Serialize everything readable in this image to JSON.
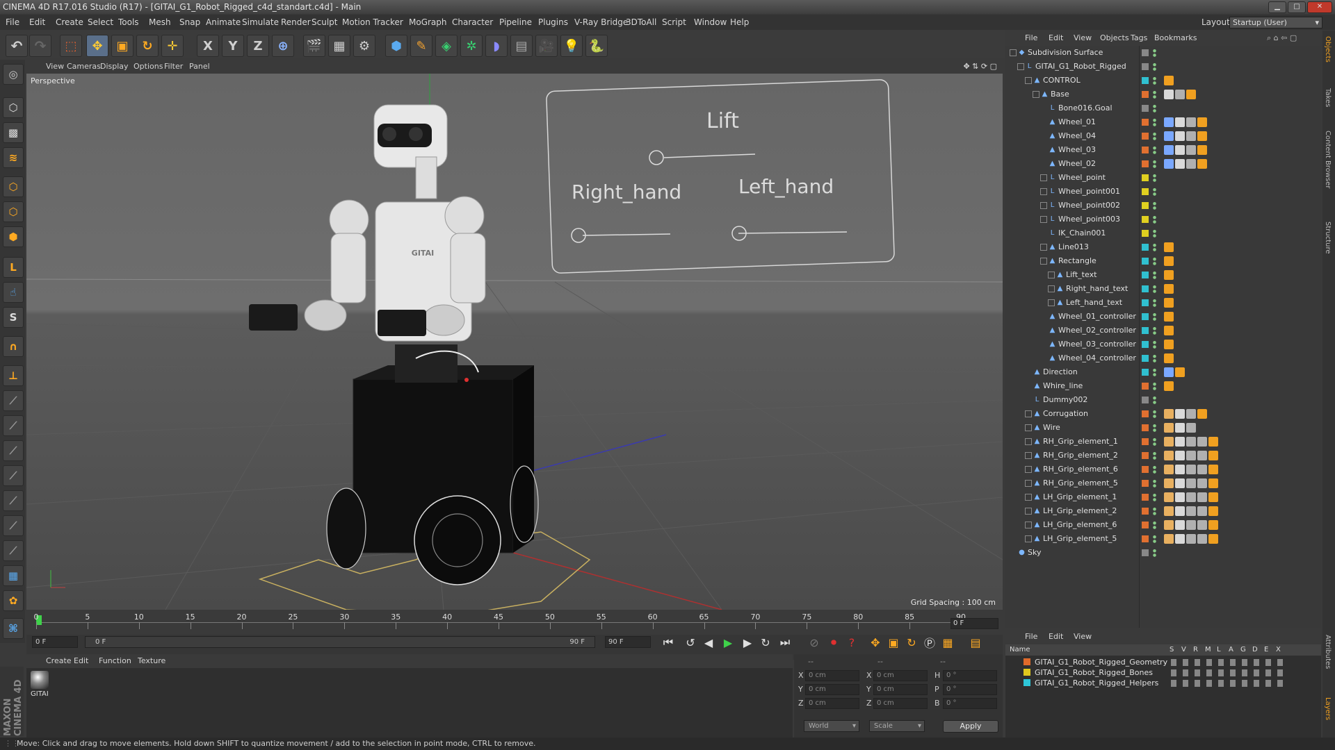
{
  "window": {
    "title": "CINEMA 4D R17.016 Studio (R17) - [GITAI_G1_Robot_Rigged_c4d_standart.c4d] - Main"
  },
  "menu": [
    "File",
    "Edit",
    "Create",
    "Select",
    "Tools",
    "Mesh",
    "Snap",
    "Animate",
    "Simulate",
    "Render",
    "Sculpt",
    "Motion Tracker",
    "MoGraph",
    "Character",
    "Pipeline",
    "Plugins",
    "V-Ray Bridge",
    "3DToAll",
    "Script",
    "Window",
    "Help"
  ],
  "layout": {
    "label": "Layout:",
    "value": "Startup (User)"
  },
  "toolbar": {
    "x_axis": "X",
    "y_axis": "Y",
    "z_axis": "Z"
  },
  "viewport": {
    "menu": [
      "View",
      "Cameras",
      "Display",
      "Options",
      "Filter",
      "Panel"
    ],
    "label": "Perspective",
    "grid_spacing": "Grid Spacing : 100 cm",
    "hud": {
      "lift": "Lift",
      "right_hand": "Right_hand",
      "left_hand": "Left_hand"
    },
    "robot_chest": "GITAI"
  },
  "timeline": {
    "ticks": [
      "0",
      "5",
      "10",
      "15",
      "20",
      "25",
      "30",
      "35",
      "40",
      "45",
      "50",
      "55",
      "60",
      "65",
      "70",
      "75",
      "80",
      "85",
      "90"
    ],
    "current_frame": "0 F",
    "start_field": "0 F",
    "range_start": "0 F",
    "range_end": "90 F",
    "end_field": "90 F"
  },
  "material_manager": {
    "menu": [
      "Create",
      "Edit",
      "Function",
      "Texture"
    ],
    "material_name": "GITAI"
  },
  "coordinates": {
    "headers": [
      "--",
      "--",
      "--"
    ],
    "rows": [
      {
        "axis": "X",
        "pos": "0 cm",
        "size_axis": "X",
        "size": "0 cm",
        "rot_axis": "H",
        "rot": "0 °"
      },
      {
        "axis": "Y",
        "pos": "0 cm",
        "size_axis": "Y",
        "size": "0 cm",
        "rot_axis": "P",
        "rot": "0 °"
      },
      {
        "axis": "Z",
        "pos": "0 cm",
        "size_axis": "Z",
        "size": "0 cm",
        "rot_axis": "B",
        "rot": "0 °"
      }
    ],
    "mode": "World",
    "scale": "Scale",
    "apply": "Apply"
  },
  "status": "Move: Click and drag to move elements. Hold down SHIFT to quantize movement / add to the selection in point mode, CTRL to remove.",
  "brand": "MAXON CINEMA 4D",
  "object_manager": {
    "menu": [
      "File",
      "Edit",
      "View",
      "Objects",
      "Tags",
      "Bookmarks"
    ],
    "items": [
      {
        "name": "Subdivision Surface",
        "indent": 0,
        "exp": "−",
        "icon": "◆",
        "color": "#888888",
        "tags": []
      },
      {
        "name": "GITAI_G1_Robot_Rigged",
        "indent": 1,
        "exp": "−",
        "icon": "L",
        "color": "#888888",
        "tags": []
      },
      {
        "name": "CONTROL",
        "indent": 2,
        "exp": "−",
        "icon": "▲",
        "color": "#30c0d0",
        "tags": [
          "o"
        ]
      },
      {
        "name": "Base",
        "indent": 3,
        "exp": "−",
        "icon": "▲",
        "color": "#e07030",
        "tags": [
          "m",
          "c",
          "o"
        ]
      },
      {
        "name": "Bone016.Goal",
        "indent": 4,
        "exp": "",
        "icon": "L",
        "color": "#888888",
        "tags": []
      },
      {
        "name": "Wheel_01",
        "indent": 4,
        "exp": "",
        "icon": "▲",
        "color": "#e07030",
        "tags": [
          "v",
          "m",
          "c",
          "o"
        ]
      },
      {
        "name": "Wheel_04",
        "indent": 4,
        "exp": "",
        "icon": "▲",
        "color": "#e07030",
        "tags": [
          "v",
          "m",
          "c",
          "o"
        ]
      },
      {
        "name": "Wheel_03",
        "indent": 4,
        "exp": "",
        "icon": "▲",
        "color": "#e07030",
        "tags": [
          "v",
          "m",
          "c",
          "o"
        ]
      },
      {
        "name": "Wheel_02",
        "indent": 4,
        "exp": "",
        "icon": "▲",
        "color": "#e07030",
        "tags": [
          "v",
          "m",
          "c",
          "o"
        ]
      },
      {
        "name": "Wheel_point",
        "indent": 4,
        "exp": "+",
        "icon": "L",
        "color": "#e0d020",
        "tags": []
      },
      {
        "name": "Wheel_point001",
        "indent": 4,
        "exp": "+",
        "icon": "L",
        "color": "#e0d020",
        "tags": []
      },
      {
        "name": "Wheel_point002",
        "indent": 4,
        "exp": "+",
        "icon": "L",
        "color": "#e0d020",
        "tags": []
      },
      {
        "name": "Wheel_point003",
        "indent": 4,
        "exp": "+",
        "icon": "L",
        "color": "#e0d020",
        "tags": []
      },
      {
        "name": "IK_Chain001",
        "indent": 4,
        "exp": "",
        "icon": "L",
        "color": "#e0d020",
        "tags": []
      },
      {
        "name": "Line013",
        "indent": 4,
        "exp": "+",
        "icon": "▲",
        "color": "#30c0d0",
        "tags": [
          "o"
        ]
      },
      {
        "name": "Rectangle",
        "indent": 4,
        "exp": "−",
        "icon": "▲",
        "color": "#30c0d0",
        "tags": [
          "o"
        ]
      },
      {
        "name": "Lift_text",
        "indent": 5,
        "exp": "+",
        "icon": "▲",
        "color": "#30c0d0",
        "tags": [
          "o"
        ]
      },
      {
        "name": "Right_hand_text",
        "indent": 5,
        "exp": "+",
        "icon": "▲",
        "color": "#30c0d0",
        "tags": [
          "o"
        ]
      },
      {
        "name": "Left_hand_text",
        "indent": 5,
        "exp": "+",
        "icon": "▲",
        "color": "#30c0d0",
        "tags": [
          "o"
        ]
      },
      {
        "name": "Wheel_01_controller",
        "indent": 4,
        "exp": "",
        "icon": "▲",
        "color": "#30c0d0",
        "tags": [
          "o"
        ]
      },
      {
        "name": "Wheel_02_controller",
        "indent": 4,
        "exp": "",
        "icon": "▲",
        "color": "#30c0d0",
        "tags": [
          "o"
        ]
      },
      {
        "name": "Wheel_03_controller",
        "indent": 4,
        "exp": "",
        "icon": "▲",
        "color": "#30c0d0",
        "tags": [
          "o"
        ]
      },
      {
        "name": "Wheel_04_controller",
        "indent": 4,
        "exp": "",
        "icon": "▲",
        "color": "#30c0d0",
        "tags": [
          "o"
        ]
      },
      {
        "name": "Direction",
        "indent": 2,
        "exp": "",
        "icon": "▲",
        "color": "#30c0d0",
        "tags": [
          "v",
          "o"
        ]
      },
      {
        "name": "Whire_line",
        "indent": 2,
        "exp": "",
        "icon": "▲",
        "color": "#e07030",
        "tags": [
          "o"
        ]
      },
      {
        "name": "Dummy002",
        "indent": 2,
        "exp": "",
        "icon": "L",
        "color": "#888888",
        "tags": []
      },
      {
        "name": "Corrugation",
        "indent": 2,
        "exp": "+",
        "icon": "▲",
        "color": "#e07030",
        "tags": [
          "s",
          "m",
          "c",
          "o"
        ]
      },
      {
        "name": "Wire",
        "indent": 2,
        "exp": "+",
        "icon": "▲",
        "color": "#e07030",
        "tags": [
          "s",
          "m",
          "c"
        ]
      },
      {
        "name": "RH_Grip_element_1",
        "indent": 2,
        "exp": "+",
        "icon": "▲",
        "color": "#e07030",
        "tags": [
          "s",
          "m",
          "c",
          "c",
          "o"
        ]
      },
      {
        "name": "RH_Grip_element_2",
        "indent": 2,
        "exp": "+",
        "icon": "▲",
        "color": "#e07030",
        "tags": [
          "s",
          "m",
          "c",
          "c",
          "o"
        ]
      },
      {
        "name": "RH_Grip_element_6",
        "indent": 2,
        "exp": "+",
        "icon": "▲",
        "color": "#e07030",
        "tags": [
          "s",
          "m",
          "c",
          "c",
          "o"
        ]
      },
      {
        "name": "RH_Grip_element_5",
        "indent": 2,
        "exp": "+",
        "icon": "▲",
        "color": "#e07030",
        "tags": [
          "s",
          "m",
          "c",
          "c",
          "o"
        ]
      },
      {
        "name": "LH_Grip_element_1",
        "indent": 2,
        "exp": "+",
        "icon": "▲",
        "color": "#e07030",
        "tags": [
          "s",
          "m",
          "c",
          "c",
          "o"
        ]
      },
      {
        "name": "LH_Grip_element_2",
        "indent": 2,
        "exp": "+",
        "icon": "▲",
        "color": "#e07030",
        "tags": [
          "s",
          "m",
          "c",
          "c",
          "o"
        ]
      },
      {
        "name": "LH_Grip_element_6",
        "indent": 2,
        "exp": "+",
        "icon": "▲",
        "color": "#e07030",
        "tags": [
          "s",
          "m",
          "c",
          "c",
          "o"
        ]
      },
      {
        "name": "LH_Grip_element_5",
        "indent": 2,
        "exp": "+",
        "icon": "▲",
        "color": "#e07030",
        "tags": [
          "s",
          "m",
          "c",
          "c",
          "o"
        ]
      },
      {
        "name": "Sky",
        "indent": 0,
        "exp": "",
        "icon": "●",
        "color": "#888888",
        "tags": []
      }
    ]
  },
  "layer_manager": {
    "menu": [
      "File",
      "Edit",
      "View"
    ],
    "columns": [
      "Name",
      "S",
      "V",
      "R",
      "M",
      "L",
      "A",
      "G",
      "D",
      "E",
      "X"
    ],
    "layers": [
      {
        "name": "GITAI_G1_Robot_Rigged_Geometry",
        "color": "#e06a2a"
      },
      {
        "name": "GITAI_G1_Robot_Rigged_Bones",
        "color": "#e0c81e"
      },
      {
        "name": "GITAI_G1_Robot_Rigged_Helpers",
        "color": "#2ec6d8"
      }
    ]
  },
  "side_tabs": [
    "Objects",
    "Takes",
    "Content Browser",
    "Structure"
  ],
  "side_tabs_lower": [
    "Attributes",
    "Layers"
  ]
}
